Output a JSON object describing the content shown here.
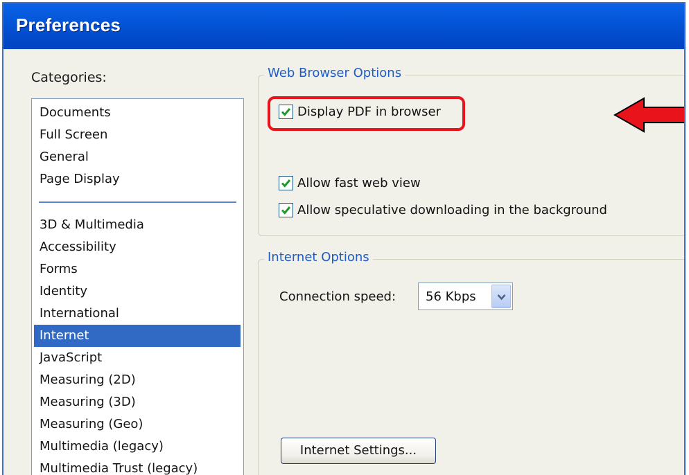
{
  "window": {
    "title": "Preferences"
  },
  "categories": {
    "label": "Categories:",
    "items": [
      "Documents",
      "Full Screen",
      "General",
      "Page Display",
      "3D & Multimedia",
      "Accessibility",
      "Forms",
      "Identity",
      "International",
      "Internet",
      "JavaScript",
      "Measuring (2D)",
      "Measuring (3D)",
      "Measuring (Geo)",
      "Multimedia (legacy)",
      "Multimedia Trust (legacy)"
    ],
    "selected": "Internet"
  },
  "web_browser_options": {
    "legend": "Web Browser Options",
    "display_pdf": {
      "label": "Display PDF in browser",
      "checked": true
    },
    "fast_web_view": {
      "label": "Allow fast web view",
      "checked": true
    },
    "speculative_download": {
      "label": "Allow speculative downloading in the background",
      "checked": true
    }
  },
  "internet_options": {
    "legend": "Internet Options",
    "connection_speed_label": "Connection speed:",
    "connection_speed_value": "56 Kbps",
    "settings_button": "Internet Settings..."
  },
  "colors": {
    "titlebar": "#0454d6",
    "selection": "#316ac5",
    "highlight": "#e8131b",
    "arrow": "#e8131b",
    "legend_text": "#1f5cc6"
  }
}
